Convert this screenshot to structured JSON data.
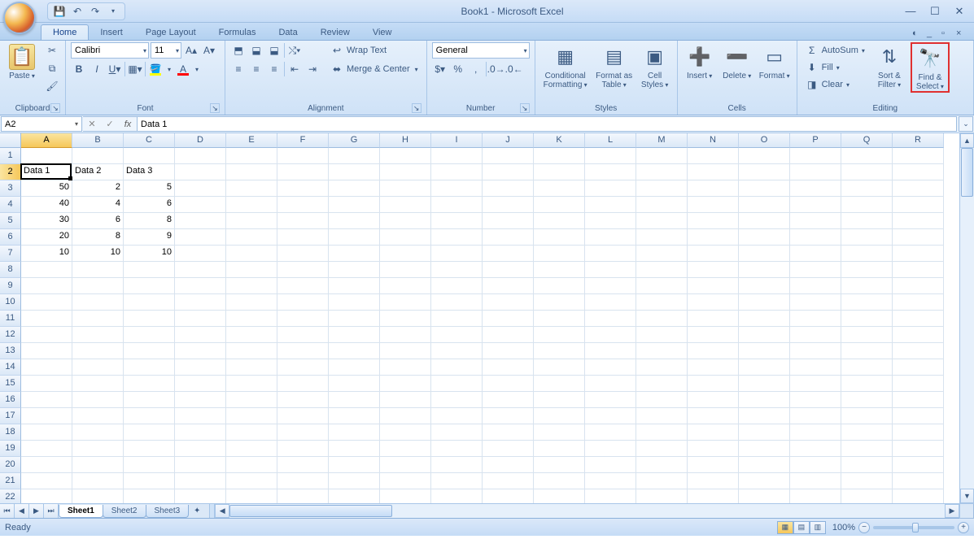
{
  "title": "Book1 - Microsoft Excel",
  "tabs": [
    "Home",
    "Insert",
    "Page Layout",
    "Formulas",
    "Data",
    "Review",
    "View"
  ],
  "active_tab": "Home",
  "ribbon": {
    "clipboard": {
      "label": "Clipboard",
      "paste": "Paste"
    },
    "font": {
      "label": "Font",
      "font_name": "Calibri",
      "font_size": "11"
    },
    "alignment": {
      "label": "Alignment",
      "wrap": "Wrap Text",
      "merge": "Merge & Center"
    },
    "number": {
      "label": "Number",
      "format": "General"
    },
    "styles": {
      "label": "Styles",
      "cond": "Conditional Formatting",
      "table": "Format as Table",
      "cell": "Cell Styles"
    },
    "cells": {
      "label": "Cells",
      "insert": "Insert",
      "delete": "Delete",
      "format": "Format"
    },
    "editing": {
      "label": "Editing",
      "autosum": "AutoSum",
      "fill": "Fill",
      "clear": "Clear",
      "sort": "Sort & Filter",
      "find": "Find & Select"
    }
  },
  "name_box": "A2",
  "formula": "Data 1",
  "columns": [
    "A",
    "B",
    "C",
    "D",
    "E",
    "F",
    "G",
    "H",
    "I",
    "J",
    "K",
    "L",
    "M",
    "N",
    "O",
    "P",
    "Q",
    "R"
  ],
  "rows_visible": 22,
  "selected_cell": {
    "col": 0,
    "row": 1
  },
  "cells": {
    "1": {
      "A": "Data 1",
      "B": "Data 2",
      "C": "Data 3"
    },
    "2": {
      "A": "50",
      "B": "2",
      "C": "5"
    },
    "3": {
      "A": "40",
      "B": "4",
      "C": "6"
    },
    "4": {
      "A": "30",
      "B": "6",
      "C": "8"
    },
    "5": {
      "A": "20",
      "B": "8",
      "C": "9"
    },
    "6": {
      "A": "10",
      "B": "10",
      "C": "10"
    }
  },
  "sheets": [
    "Sheet1",
    "Sheet2",
    "Sheet3"
  ],
  "active_sheet": "Sheet1",
  "status": "Ready",
  "zoom": "100%"
}
